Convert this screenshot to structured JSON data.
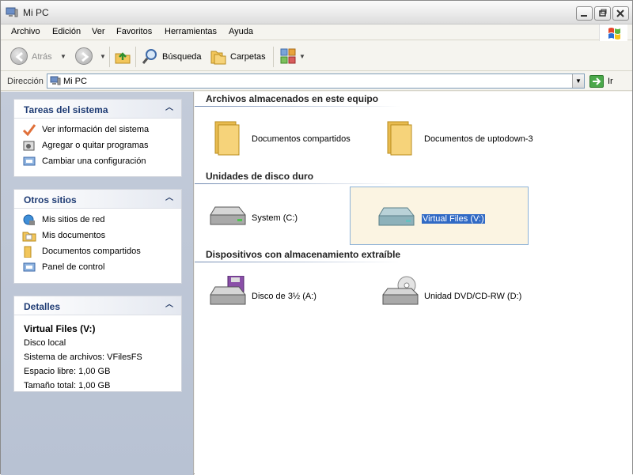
{
  "window": {
    "title": "Mi PC"
  },
  "menu": [
    "Archivo",
    "Edición",
    "Ver",
    "Favoritos",
    "Herramientas",
    "Ayuda"
  ],
  "toolbar": {
    "back": "Atrás",
    "search": "Búsqueda",
    "folders": "Carpetas"
  },
  "address": {
    "label": "Dirección",
    "value": "Mi PC",
    "go": "Ir"
  },
  "tasks": {
    "title": "Tareas del sistema",
    "items": [
      "Ver información del sistema",
      "Agregar o quitar programas",
      "Cambiar una configuración"
    ]
  },
  "places": {
    "title": "Otros sitios",
    "items": [
      "Mis sitios de red",
      "Mis documentos",
      "Documentos compartidos",
      "Panel de control"
    ]
  },
  "details": {
    "title": "Detalles",
    "name": "Virtual Files (V:)",
    "type": "Disco local",
    "fs": "Sistema de archivos: VFilesFS",
    "free": "Espacio libre: 1,00 GB",
    "total": "Tamaño total: 1,00 GB"
  },
  "groups": {
    "stored": {
      "title": "Archivos almacenados en este equipo",
      "items": [
        "Documentos compartidos",
        "Documentos de uptodown-3"
      ]
    },
    "hdd": {
      "title": "Unidades de disco duro",
      "items": [
        "System (C:)",
        "Virtual Files (V:)"
      ]
    },
    "removable": {
      "title": "Dispositivos con almacenamiento extraíble",
      "items": [
        "Disco de 3½ (A:)",
        "Unidad DVD/CD-RW (D:)"
      ]
    }
  },
  "icons": {
    "computer": "computer-icon",
    "folder": "folder-icon",
    "drive": "hard-drive-icon",
    "floppy": "floppy-drive-icon",
    "dvd": "dvd-drive-icon"
  },
  "colors": {
    "accent": "#1f3c74",
    "selection": "#316ac5",
    "selected_bg": "#fbf4e2"
  }
}
